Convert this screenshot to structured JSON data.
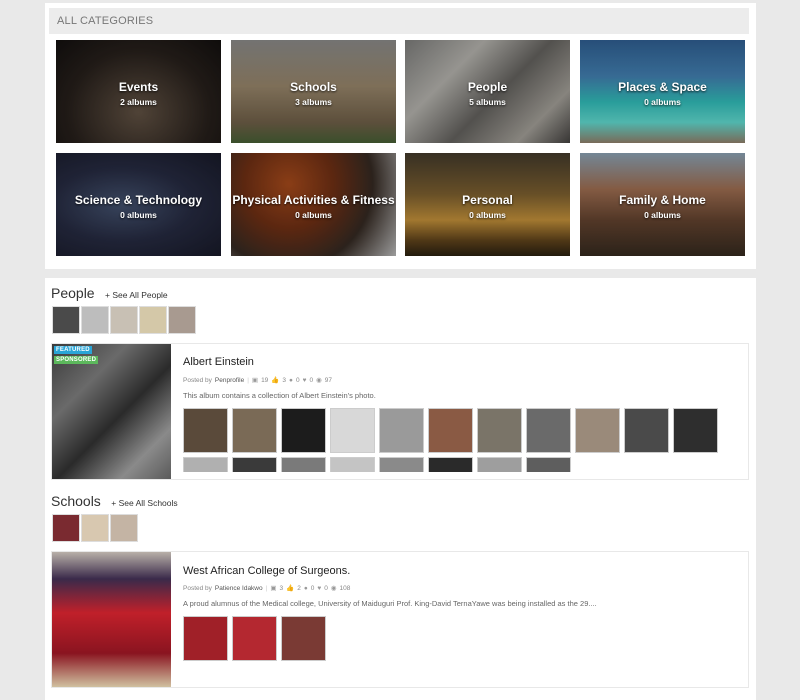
{
  "categories_header": "ALL CATEGORIES",
  "categories": [
    {
      "name": "Events",
      "count": "2 albums"
    },
    {
      "name": "Schools",
      "count": "3 albums"
    },
    {
      "name": "People",
      "count": "5 albums"
    },
    {
      "name": "Places & Space",
      "count": "0 albums"
    },
    {
      "name": "Science & Technology",
      "count": "0 albums"
    },
    {
      "name": "Physical Activities & Fitness",
      "count": "0 albums"
    },
    {
      "name": "Personal",
      "count": "0 albums"
    },
    {
      "name": "Family & Home",
      "count": "0 albums"
    }
  ],
  "people_section": {
    "title": "People",
    "see_all": "+ See All People",
    "album": {
      "badge_featured": "FEATURED",
      "badge_sponsored": "SPONSORED",
      "title": "Albert Einstein",
      "posted_by_label": "Posted by",
      "author": "Penprofile",
      "photos": "19",
      "likes": "3",
      "comments": "0",
      "favorites": "0",
      "views": "97",
      "description": "This album contains a collection of Albert Einstein's photo."
    }
  },
  "schools_section": {
    "title": "Schools",
    "see_all": "+ See All Schools",
    "album": {
      "title": "West African College of Surgeons.",
      "posted_by_label": "Posted by",
      "author": "Patience Idakwo",
      "photos": "3",
      "likes": "2",
      "comments": "0",
      "favorites": "0",
      "views": "108",
      "description": "A proud alumnus of the Medical college, University of Maiduguri Prof. King-David TernaYawe was being installed as the 29...."
    }
  },
  "colors": {
    "featured_badge": "#2aa5d6",
    "sponsored_badge": "#5cb85c"
  }
}
